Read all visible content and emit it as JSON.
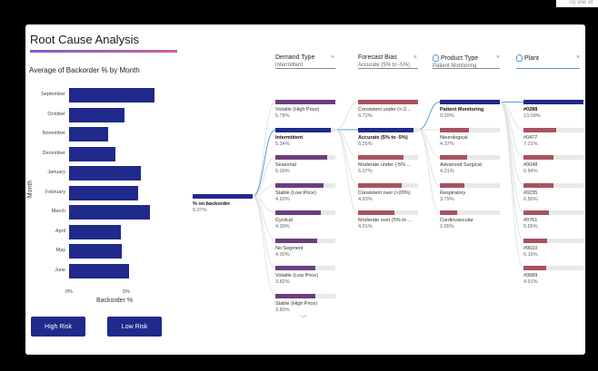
{
  "corner_text": "Try one of",
  "title": "Root Cause Analysis",
  "bar_chart": {
    "title": "Average of Backorder % by Month",
    "ylabel": "Month",
    "xlabel": "Backorder %",
    "ticks": [
      "0%",
      "5%"
    ]
  },
  "chart_data": {
    "type": "bar",
    "orientation": "horizontal",
    "title": "Average of Backorder % by Month",
    "xlabel": "Backorder %",
    "ylabel": "Month",
    "categories": [
      "September",
      "October",
      "November",
      "December",
      "January",
      "February",
      "March",
      "April",
      "May",
      "June"
    ],
    "values": [
      8.5,
      5.5,
      3.9,
      4.6,
      7.2,
      6.9,
      8.1,
      5.2,
      5.3,
      6.0
    ],
    "xlim": [
      0,
      10
    ]
  },
  "buttons": {
    "high_risk": "High Risk",
    "low_risk": "Low Risk"
  },
  "tree": {
    "root": {
      "label": "% on backorder",
      "value": "5.07%"
    },
    "columns": [
      {
        "title": "Demand Type",
        "sub": "Intermittent"
      },
      {
        "title": "Forecast Bias",
        "sub": "Accurate (5% to -5%)"
      },
      {
        "title": "Product Type",
        "sub": "Patient Monitoring"
      },
      {
        "title": "Plant",
        "sub": ""
      }
    ],
    "demand": [
      {
        "label": "Volatile (High Price)",
        "value": "5.78%",
        "frac": 1.0
      },
      {
        "label": "Intermittent",
        "value": "5.34%",
        "frac": 0.92
      },
      {
        "label": "Seasonal",
        "value": "5.00%",
        "frac": 0.87
      },
      {
        "label": "Stable (Low Price)",
        "value": "4.60%",
        "frac": 0.8
      },
      {
        "label": "Cyclical",
        "value": "4.39%",
        "frac": 0.76
      },
      {
        "label": "No Segment",
        "value": "4.00%",
        "frac": 0.69
      },
      {
        "label": "Volatile (Low Price)",
        "value": "3.82%",
        "frac": 0.66
      },
      {
        "label": "Stable (High Price)",
        "value": "3.80%",
        "frac": 0.66
      }
    ],
    "forecast": [
      {
        "label": "Consistent under (<-2...",
        "value": "6.72%",
        "frac": 1.0
      },
      {
        "label": "Accurate (5% to -5%)",
        "value": "6.25%",
        "frac": 0.93
      },
      {
        "label": "Moderate under (-5% ...",
        "value": "5.07%",
        "frac": 0.75
      },
      {
        "label": "Consistent over (>20%)",
        "value": "4.93%",
        "frac": 0.73
      },
      {
        "label": "Moderate over (5% to ...",
        "value": "4.01%",
        "frac": 0.6
      }
    ],
    "product": [
      {
        "label": "Patient Monitoring",
        "value": "9.20%",
        "frac": 1.0
      },
      {
        "label": "Neurological",
        "value": "4.37%",
        "frac": 0.48
      },
      {
        "label": "Advanced Surgical",
        "value": "4.21%",
        "frac": 0.46
      },
      {
        "label": "Respiratory",
        "value": "3.79%",
        "frac": 0.41
      },
      {
        "label": "Cardiovascular",
        "value": "2.65%",
        "frac": 0.29
      }
    ],
    "plant": [
      {
        "label": "#0288",
        "value": "13.09%",
        "frac": 1.0
      },
      {
        "label": "#0477",
        "value": "7.21%",
        "frac": 0.55
      },
      {
        "label": "#0048",
        "value": "6.54%",
        "frac": 0.5
      },
      {
        "label": "#0235",
        "value": "6.50%",
        "frac": 0.5
      },
      {
        "label": "#0761",
        "value": "5.65%",
        "frac": 0.43
      },
      {
        "label": "#0610",
        "value": "5.16%",
        "frac": 0.39
      },
      {
        "label": "#0689",
        "value": "4.91%",
        "frac": 0.38
      }
    ],
    "selected": {
      "demand": 1,
      "forecast": 1,
      "product": 0,
      "plant": 0
    }
  },
  "colors": {
    "navy": "#1f2a8a",
    "purple": "#6b3e7e",
    "rose": "#a8525f",
    "accent_line": "#5a9bd5"
  }
}
